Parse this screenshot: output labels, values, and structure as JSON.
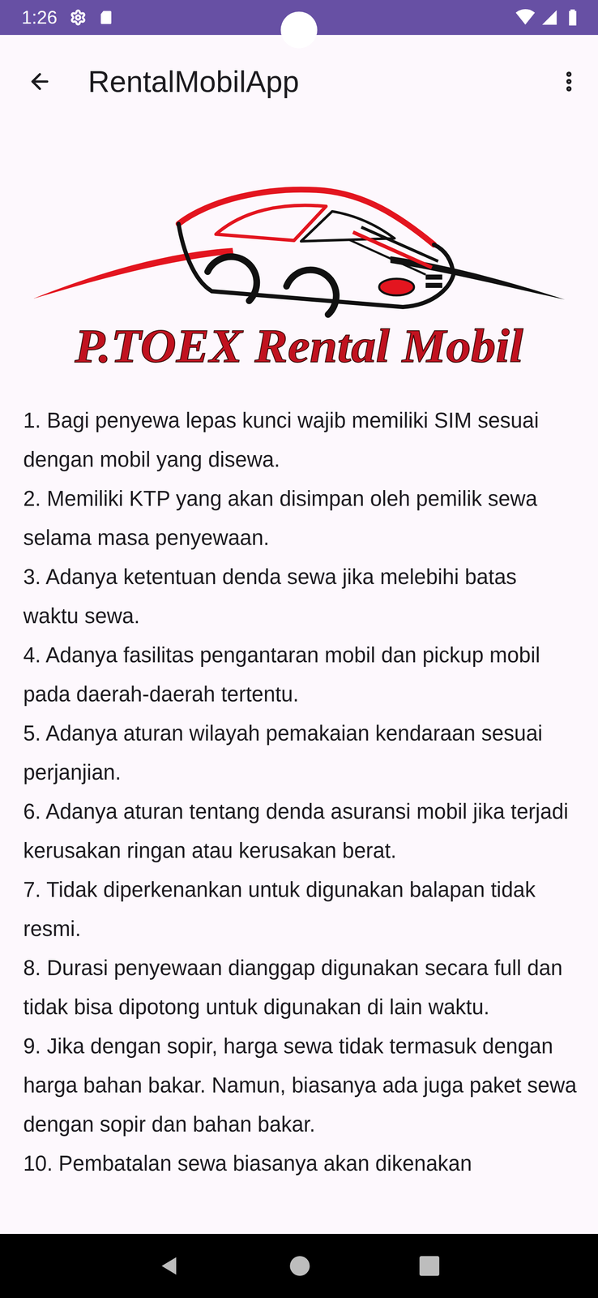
{
  "status_bar": {
    "time": "1:26"
  },
  "app_bar": {
    "title": "RentalMobilApp"
  },
  "logo": {
    "text": "P.TOEX Rental Mobil"
  },
  "terms": [
    "1. Bagi penyewa lepas kunci wajib memiliki SIM sesuai dengan mobil yang disewa.",
    "2. Memiliki KTP yang akan disimpan oleh pemilik sewa selama masa penyewaan.",
    "3. Adanya ketentuan denda sewa jika melebihi batas waktu sewa.",
    "4. Adanya fasilitas pengantaran mobil dan pickup mobil pada daerah-daerah tertentu.",
    "5. Adanya aturan wilayah pemakaian kendaraan sesuai perjanjian.",
    "6. Adanya aturan tentang denda asuransi mobil jika terjadi kerusakan ringan atau kerusakan berat.",
    "7. Tidak diperkenankan untuk digunakan balapan tidak resmi.",
    "8. Durasi penyewaan dianggap digunakan secara full dan tidak bisa dipotong untuk digunakan di lain waktu.",
    "9. Jika dengan sopir, harga sewa tidak termasuk dengan harga bahan bakar. Namun, biasanya ada juga paket sewa dengan sopir dan bahan bakar.",
    "10. Pembatalan sewa biasanya akan dikenakan"
  ]
}
